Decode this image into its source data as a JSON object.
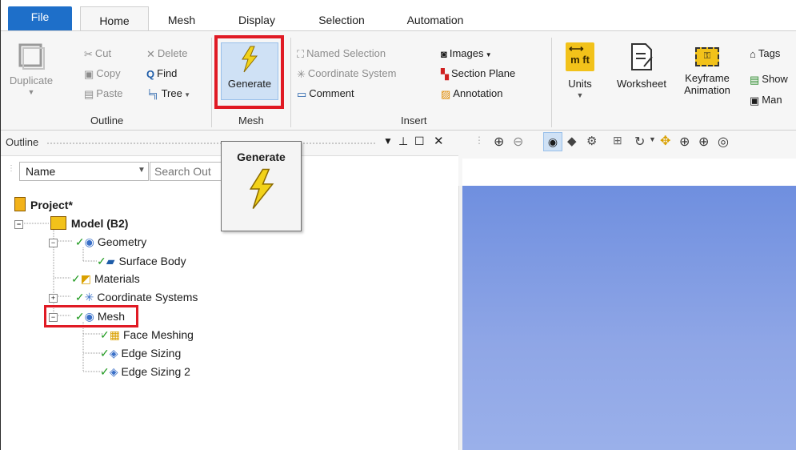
{
  "tabs": {
    "file": "File",
    "home": "Home",
    "mesh": "Mesh",
    "display": "Display",
    "selection": "Selection",
    "automation": "Automation"
  },
  "ribbon": {
    "outline": {
      "duplicate": "Duplicate",
      "cut": "Cut",
      "copy": "Copy",
      "paste": "Paste",
      "delete": "Delete",
      "find": "Find",
      "tree": "Tree",
      "group": "Outline"
    },
    "mesh": {
      "generate": "Generate",
      "group": "Mesh"
    },
    "insert": {
      "named_selection": "Named Selection",
      "coordinate_system": "Coordinate System",
      "comment": "Comment",
      "images": "Images",
      "section_plane": "Section Plane",
      "annotation": "Annotation",
      "group": "Insert"
    },
    "units": {
      "label": "Units",
      "icon_text": "m ft"
    },
    "worksheet": "Worksheet",
    "keyframe": {
      "line1": "Keyframe",
      "line2": "Animation"
    },
    "tags": "Tags",
    "show": "Show",
    "man": "Man"
  },
  "tooltip": {
    "title": "Generate"
  },
  "outline": {
    "title": "Outline",
    "col_name": "Name",
    "search_placeholder": "Search Out"
  },
  "tree": {
    "project": "Project*",
    "model": "Model (B2)",
    "geometry": "Geometry",
    "surface_body": "Surface Body",
    "materials": "Materials",
    "coordinate_systems": "Coordinate Systems",
    "mesh": "Mesh",
    "face_meshing": "Face Meshing",
    "edge_sizing": "Edge Sizing",
    "edge_sizing_2": "Edge Sizing 2"
  },
  "colors": {
    "file_tab": "#1e6fc9",
    "highlight": "#e01a24",
    "viewer_top": "#6f8fdf",
    "check": "#1f9a1f",
    "bolt": "#f2d21a"
  }
}
